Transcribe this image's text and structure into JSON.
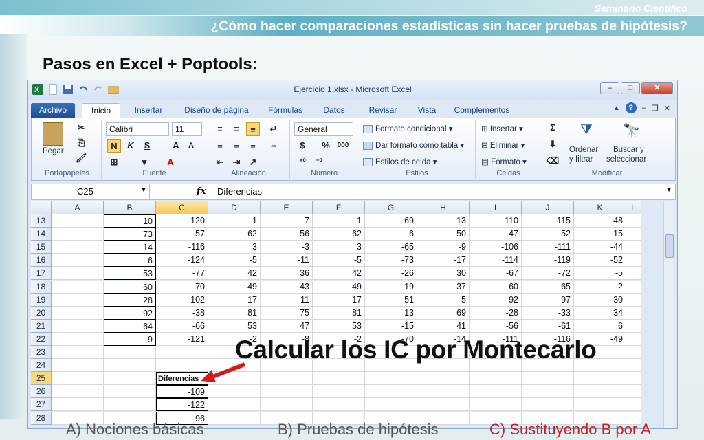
{
  "slide": {
    "brand": "Seminario Científico",
    "title": "¿Cómo hacer comparaciones estadísticas sin hacer pruebas de hipótesis?",
    "heading": "Pasos en Excel + Poptools:",
    "callout": "Calcular los IC por Montecarlo",
    "footer": [
      "A) Nociones básicas",
      "B) Pruebas de hipótesis",
      "C) Sustituyendo B por A"
    ]
  },
  "excel": {
    "window_title": "Ejercicio 1.xlsx  -  Microsoft Excel",
    "tabs": [
      "Archivo",
      "Inicio",
      "Insertar",
      "Diseño de página",
      "Fórmulas",
      "Datos",
      "Revisar",
      "Vista",
      "Complementos"
    ],
    "active_tab": "Inicio",
    "ribbon": {
      "portapapeles": {
        "paste": "Pegar",
        "label": "Portapapeles"
      },
      "fuente": {
        "font": "Calibri",
        "size": "11",
        "bold": "N",
        "italic": "K",
        "underline": "S",
        "grow": "A",
        "shrink": "A",
        "label": "Fuente"
      },
      "alineacion": {
        "label": "Alineación"
      },
      "numero": {
        "format": "General",
        "currency": "$",
        "percent": "%",
        "thousands": "000",
        "label": "Número"
      },
      "estilos": {
        "cond": "Formato condicional",
        "table": "Dar formato como tabla",
        "cell": "Estilos de celda",
        "label": "Estilos"
      },
      "celdas": {
        "insert": "Insertar",
        "delete": "Eliminar",
        "format": "Formato",
        "label": "Celdas"
      },
      "modificar": {
        "sum": "Σ",
        "sort1": "Ordenar",
        "sort2": "y filtrar",
        "find1": "Buscar y",
        "find2": "seleccionar",
        "label": "Modificar"
      }
    },
    "namebox": "C25",
    "formula": "Diferencias",
    "columns": [
      "A",
      "B",
      "C",
      "D",
      "E",
      "F",
      "G",
      "H",
      "I",
      "J",
      "K",
      "L"
    ],
    "selected_column": "C",
    "selected_row": "25",
    "rows": [
      {
        "n": "13",
        "B": "10",
        "C": "-120",
        "D": "-1",
        "E": "-7",
        "F": "-1",
        "G": "-69",
        "H": "-13",
        "I": "-110",
        "J": "-115",
        "K": "-48"
      },
      {
        "n": "14",
        "B": "73",
        "C": "-57",
        "D": "62",
        "E": "56",
        "F": "62",
        "G": "-6",
        "H": "50",
        "I": "-47",
        "J": "-52",
        "K": "15"
      },
      {
        "n": "15",
        "B": "14",
        "C": "-116",
        "D": "3",
        "E": "-3",
        "F": "3",
        "G": "-65",
        "H": "-9",
        "I": "-106",
        "J": "-111",
        "K": "-44"
      },
      {
        "n": "16",
        "B": "6",
        "C": "-124",
        "D": "-5",
        "E": "-11",
        "F": "-5",
        "G": "-73",
        "H": "-17",
        "I": "-114",
        "J": "-119",
        "K": "-52"
      },
      {
        "n": "17",
        "B": "53",
        "C": "-77",
        "D": "42",
        "E": "36",
        "F": "42",
        "G": "-26",
        "H": "30",
        "I": "-67",
        "J": "-72",
        "K": "-5"
      },
      {
        "n": "18",
        "B": "60",
        "C": "-70",
        "D": "49",
        "E": "43",
        "F": "49",
        "G": "-19",
        "H": "37",
        "I": "-60",
        "J": "-65",
        "K": "2"
      },
      {
        "n": "19",
        "B": "28",
        "C": "-102",
        "D": "17",
        "E": "11",
        "F": "17",
        "G": "-51",
        "H": "5",
        "I": "-92",
        "J": "-97",
        "K": "-30"
      },
      {
        "n": "20",
        "B": "92",
        "C": "-38",
        "D": "81",
        "E": "75",
        "F": "81",
        "G": "13",
        "H": "69",
        "I": "-28",
        "J": "-33",
        "K": "34"
      },
      {
        "n": "21",
        "B": "64",
        "C": "-66",
        "D": "53",
        "E": "47",
        "F": "53",
        "G": "-15",
        "H": "41",
        "I": "-56",
        "J": "-61",
        "K": "6"
      },
      {
        "n": "22",
        "B": "9",
        "C": "-121",
        "D": "-2",
        "E": "-8",
        "F": "-2",
        "G": "-70",
        "H": "-14",
        "I": "-111",
        "J": "-116",
        "K": "-49"
      },
      {
        "n": "23"
      },
      {
        "n": "24"
      },
      {
        "n": "25",
        "C": "Diferencias"
      },
      {
        "n": "26",
        "C": "-109"
      },
      {
        "n": "27",
        "C": "-122"
      },
      {
        "n": "28",
        "C": "-96"
      }
    ]
  },
  "colors": {
    "accent": "#5fb0c4",
    "callout_arrow": "#d01c1c",
    "selection": "#f9d87e"
  }
}
